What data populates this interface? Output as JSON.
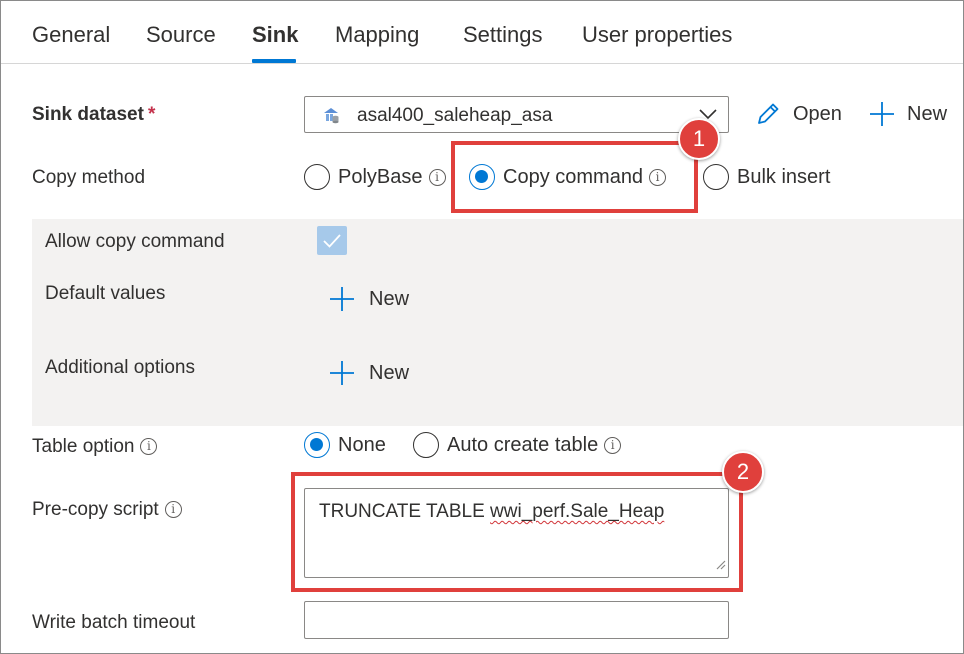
{
  "tabs": [
    {
      "label": "General"
    },
    {
      "label": "Source"
    },
    {
      "label": "Sink",
      "active": true
    },
    {
      "label": "Mapping"
    },
    {
      "label": "Settings"
    },
    {
      "label": "User properties"
    }
  ],
  "sink_dataset": {
    "label": "Sink dataset",
    "required_mark": "*",
    "value": "asal400_saleheap_asa",
    "open_label": "Open",
    "new_label": "New"
  },
  "copy_method": {
    "label": "Copy method",
    "options": [
      {
        "label": "PolyBase",
        "checked": false
      },
      {
        "label": "Copy command",
        "checked": true
      },
      {
        "label": "Bulk insert",
        "checked": false
      }
    ]
  },
  "copy_command": {
    "allow_label": "Allow copy command",
    "allow_checked": true,
    "default_values_label": "Default values",
    "default_values_new": "New",
    "additional_options_label": "Additional options",
    "additional_options_new": "New"
  },
  "table_option": {
    "label": "Table option",
    "options": [
      {
        "label": "None",
        "checked": true
      },
      {
        "label": "Auto create table",
        "checked": false
      }
    ]
  },
  "pre_copy_script": {
    "label": "Pre-copy script",
    "value_plain": "TRUNCATE TABLE ",
    "value_flagged": "wwi_perf.Sale_Heap"
  },
  "write_batch_timeout": {
    "label": "Write batch timeout",
    "value": ""
  },
  "callouts": [
    "1",
    "2"
  ],
  "colors": {
    "accent": "#0078d4",
    "callout": "#e0403c",
    "panel": "#f3f2f1"
  }
}
